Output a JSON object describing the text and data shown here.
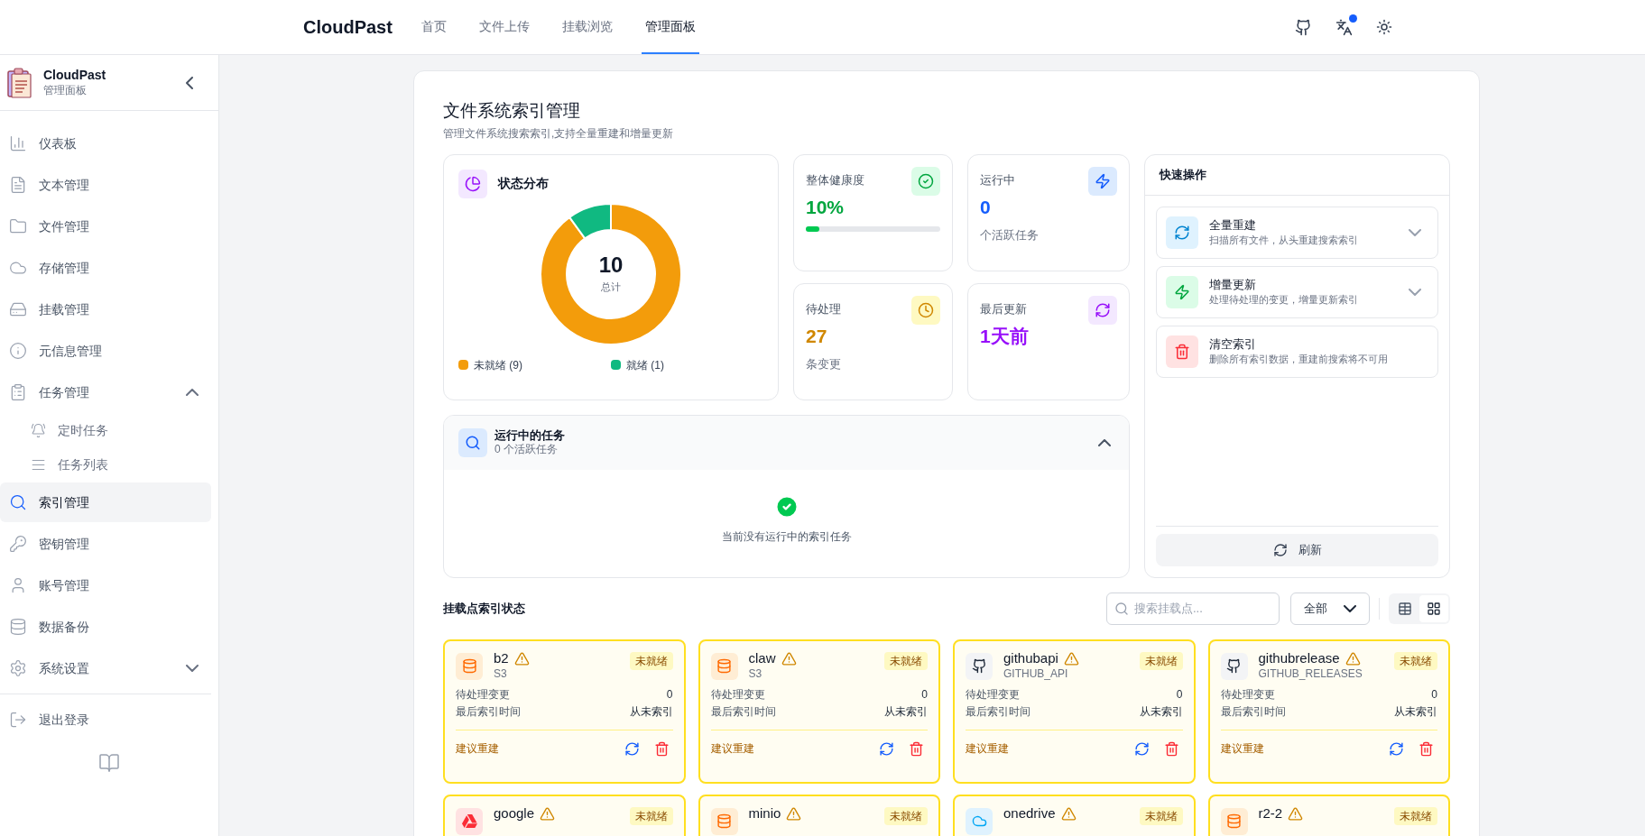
{
  "top_nav": {
    "brand": "CloudPast",
    "tabs": [
      {
        "label": "首页",
        "selected": false
      },
      {
        "label": "文件上传",
        "selected": false
      },
      {
        "label": "挂载浏览",
        "selected": false
      },
      {
        "label": "管理面板",
        "selected": true
      }
    ]
  },
  "sidebar": {
    "title": "CloudPast",
    "subtitle": "管理面板",
    "items": [
      {
        "label": "仪表板",
        "selected": false
      },
      {
        "label": "文本管理",
        "selected": false
      },
      {
        "label": "文件管理",
        "selected": false
      },
      {
        "label": "存储管理",
        "selected": false
      },
      {
        "label": "挂载管理",
        "selected": false
      },
      {
        "label": "元信息管理",
        "selected": false
      },
      {
        "label": "任务管理",
        "selected": false,
        "expanded": true,
        "children": [
          {
            "label": "定时任务",
            "selected": false
          },
          {
            "label": "任务列表",
            "selected": false
          }
        ]
      },
      {
        "label": "索引管理",
        "selected": true
      },
      {
        "label": "密钥管理",
        "selected": false
      },
      {
        "label": "账号管理",
        "selected": false
      },
      {
        "label": "数据备份",
        "selected": false
      },
      {
        "label": "系统设置",
        "selected": false,
        "expanded": false
      }
    ],
    "logout": "退出登录"
  },
  "page": {
    "title": "文件系统索引管理",
    "subtitle": "管理文件系统搜索索引,支持全量重建和增量更新"
  },
  "status_card": {
    "title": "状态分布",
    "total": "10",
    "total_label": "总计",
    "chart_data": {
      "type": "donut",
      "categories": [
        "未就绪 (9)",
        "就绪 (1)"
      ],
      "values": [
        9,
        1
      ],
      "colors": [
        "#f39c0b",
        "#10b981"
      ]
    }
  },
  "stats": [
    {
      "kind": "health",
      "label": "整体健康度",
      "value": "10%",
      "level": 0.1
    },
    {
      "kind": "running",
      "label": "运行中",
      "value": "0",
      "note": "个活跃任务"
    },
    {
      "kind": "pending",
      "label": "待处理",
      "value": "27",
      "note": "条变更"
    },
    {
      "kind": "updated",
      "label": "最后更新",
      "value": "1天前"
    }
  ],
  "running_tasks": {
    "title": "运行中的任务",
    "subtitle": "0 个活跃任务",
    "expanded": true,
    "empty_text": "当前没有运行中的索引任务"
  },
  "quick_actions": {
    "title": "快速操作",
    "items": [
      {
        "kind": "rebuild",
        "title": "全量重建",
        "desc": "扫描所有文件，从头重建搜索索引",
        "expanded": false
      },
      {
        "kind": "update",
        "title": "增量更新",
        "desc": "处理待处理的变更，增量更新索引",
        "expanded": false
      },
      {
        "kind": "clear",
        "title": "清空索引",
        "desc": "删除所有索引数据，重建前搜索将不可用"
      }
    ],
    "refresh": "刷新"
  },
  "mounts": {
    "title": "挂载点索引状态",
    "search_placeholder": "搜索挂载点...",
    "filter": "全部",
    "view_buttons": [
      {
        "kind": "table",
        "selected": false
      },
      {
        "kind": "grid",
        "selected": true
      }
    ],
    "cards": [
      {
        "name": "b2",
        "type": "S3",
        "kind": "s3",
        "status": "未就绪",
        "pending_label": "待处理变更",
        "pending": "0",
        "last_label": "最后索引时间",
        "last": "从未索引",
        "hint": "建议重建"
      },
      {
        "name": "claw",
        "type": "S3",
        "kind": "s3",
        "status": "未就绪",
        "pending_label": "待处理变更",
        "pending": "0",
        "last_label": "最后索引时间",
        "last": "从未索引",
        "hint": "建议重建"
      },
      {
        "name": "githubapi",
        "type": "GITHUB_API",
        "kind": "github",
        "status": "未就绪",
        "pending_label": "待处理变更",
        "pending": "0",
        "last_label": "最后索引时间",
        "last": "从未索引",
        "hint": "建议重建"
      },
      {
        "name": "githubrelease",
        "type": "GITHUB_RELEASES",
        "kind": "github",
        "status": "未就绪",
        "pending_label": "待处理变更",
        "pending": "0",
        "last_label": "最后索引时间",
        "last": "从未索引",
        "hint": "建议重建"
      },
      {
        "name": "google",
        "kind": "gdrive",
        "status": "未就绪"
      },
      {
        "name": "minio",
        "kind": "s3",
        "status": "未就绪"
      },
      {
        "name": "onedrive",
        "kind": "onedrive",
        "status": "未就绪"
      },
      {
        "name": "r2-2",
        "kind": "s3",
        "status": "未就绪"
      }
    ]
  }
}
